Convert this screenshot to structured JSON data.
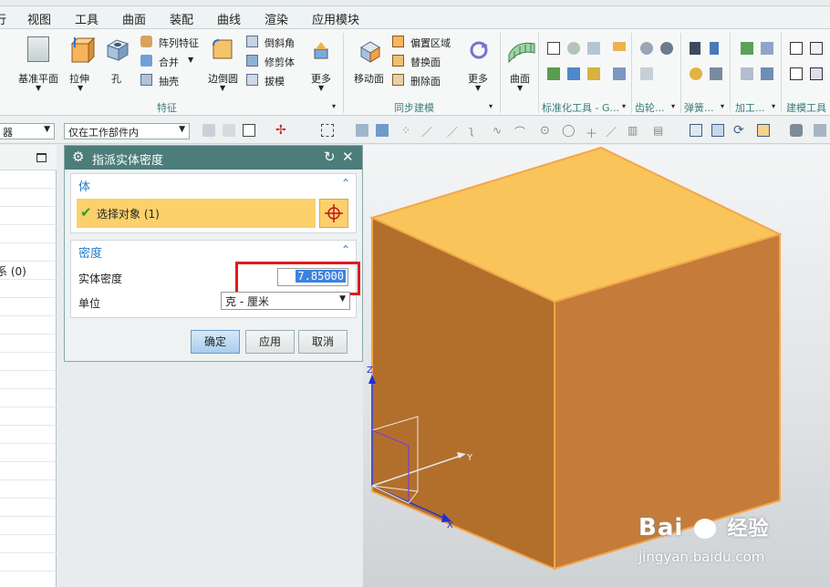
{
  "menubar": {
    "items": [
      "行",
      "视图",
      "工具",
      "曲面",
      "装配",
      "曲线",
      "渲染",
      "应用模块"
    ]
  },
  "ribbon": {
    "big_buttons": [
      {
        "label": "基准平面",
        "icon": "datum-plane-icon"
      },
      {
        "label": "拉伸",
        "icon": "extrude-icon"
      },
      {
        "label": "孔",
        "icon": "hole-icon"
      },
      {
        "label": "边倒圆",
        "icon": "edge-blend-icon"
      },
      {
        "label": "更多",
        "icon": "more-icon"
      },
      {
        "label": "移动面",
        "icon": "move-face-icon"
      },
      {
        "label": "更多",
        "icon": "more-icon"
      },
      {
        "label": "曲面",
        "icon": "surface-icon"
      }
    ],
    "small_buttons": [
      {
        "label": "阵列特征",
        "icon": "pattern-feature-icon"
      },
      {
        "label": "合并",
        "icon": "unite-icon"
      },
      {
        "label": "抽壳",
        "icon": "shell-icon"
      },
      {
        "label": "倒斜角",
        "icon": "chamfer-icon"
      },
      {
        "label": "修剪体",
        "icon": "trim-body-icon"
      },
      {
        "label": "拔模",
        "icon": "draft-icon"
      },
      {
        "label": "偏置区域",
        "icon": "offset-region-icon"
      },
      {
        "label": "替换面",
        "icon": "replace-face-icon"
      },
      {
        "label": "删除面",
        "icon": "delete-face-icon"
      }
    ],
    "groups": [
      "特征",
      "同步建模",
      "标准化工具 - G...",
      "齿轮...",
      "弹簧...",
      "加工...",
      "建模工具"
    ]
  },
  "toolbar2": {
    "filter_combo": "器",
    "scope_combo": "仅在工作部件内"
  },
  "leftpanel": {
    "row_text": "系 (0)"
  },
  "dialog": {
    "title": "指派实体密度",
    "body_section": {
      "title": "体",
      "select_label": "选择对象 (1)"
    },
    "density_section": {
      "title": "密度",
      "density_label": "实体密度",
      "density_value": "7.85000",
      "unit_label": "单位",
      "unit_value": "克 - 厘米"
    },
    "buttons": {
      "ok": "确定",
      "apply": "应用",
      "cancel": "取消"
    }
  },
  "viewport": {
    "axes": {
      "x": "X",
      "y": "Y",
      "z": "Z"
    },
    "cube_colors": {
      "top": "#f9c45a",
      "left": "#b26f2c",
      "right": "#c57c3a",
      "edge": "#f3a64b"
    },
    "highlight_color": "#e0191e"
  },
  "watermark": {
    "brand": "Bai",
    "brand2": "经验",
    "url": "jingyan.baidu.com"
  }
}
